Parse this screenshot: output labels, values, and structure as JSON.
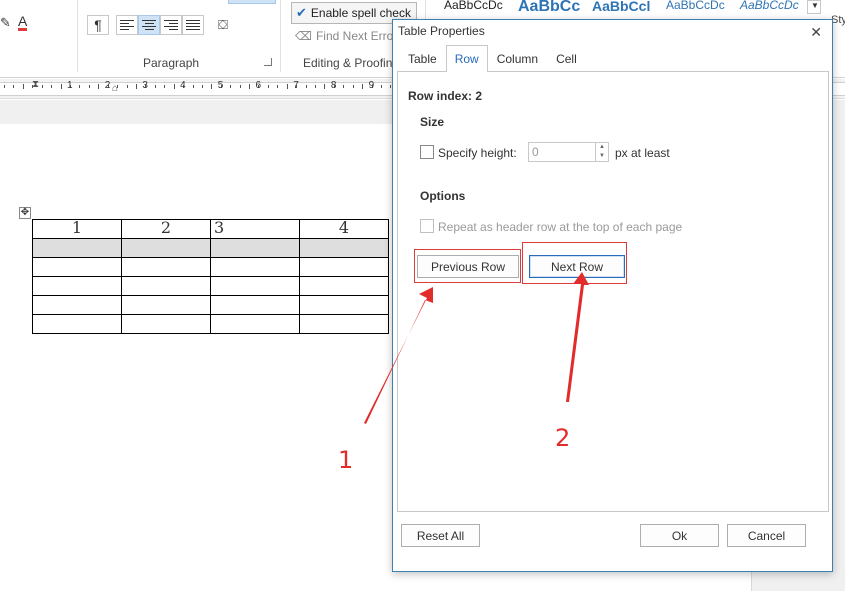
{
  "ribbon": {
    "paragraph_label": "Paragraph",
    "editing_label": "Editing & Proofing",
    "spell_check_label": "Enable spell check",
    "find_next_label": "Find Next Error",
    "pilcrow_glyph": "¶",
    "font_color_glyph": "A",
    "styles": [
      "AaBbCcDc",
      "AaBbCc",
      "AaBbCcl",
      "AaBbCcDc",
      "AaBbCcDc"
    ],
    "styles_overflow": "Sty"
  },
  "ruler": {
    "numbers": [
      "1",
      "2",
      "3",
      "4",
      "5",
      "6",
      "7",
      "8",
      "9"
    ]
  },
  "document": {
    "table_header": [
      "1",
      "2",
      "3",
      "4"
    ],
    "empty_rows": 5,
    "selected_row": 2
  },
  "dialog": {
    "title": "Table Properties",
    "close_glyph": "✕",
    "tabs": [
      "Table",
      "Row",
      "Column",
      "Cell"
    ],
    "active_tab": "Row",
    "row_index_label": "Row index: 2",
    "size_heading": "Size",
    "specify_height_label": "Specify height:",
    "height_value": "0",
    "height_unit": "px at least",
    "options_heading": "Options",
    "repeat_header_label": "Repeat as header row at the top of each page",
    "previous_row_label": "Previous Row",
    "next_row_label": "Next Row",
    "reset_all_label": "Reset All",
    "ok_label": "Ok",
    "cancel_label": "Cancel"
  },
  "annotations": {
    "marker_1": "1",
    "marker_2": "2",
    "color": "#e22b2b"
  },
  "colors": {
    "accent": "#2b6cb8",
    "dialog_border": "#3c7fb1",
    "highlight_box": "#e03b3b"
  }
}
